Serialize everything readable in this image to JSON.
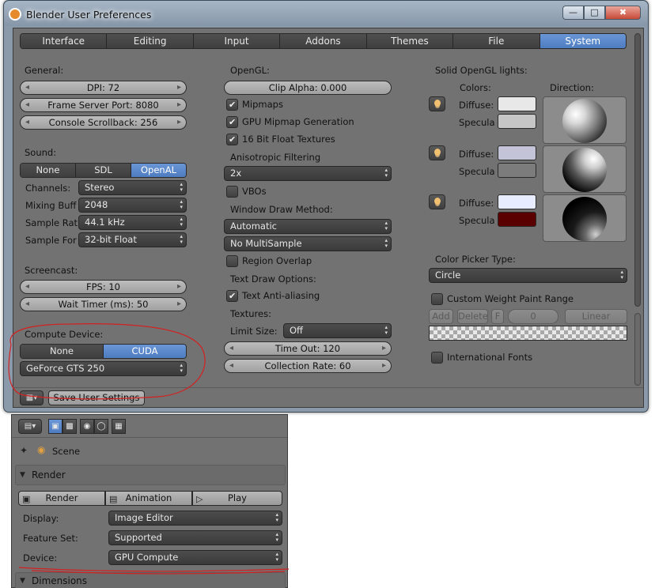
{
  "window": {
    "title": "Blender User Preferences",
    "controls": {
      "minimize": "—",
      "maximize": "□",
      "close": "✖"
    }
  },
  "tabs": [
    "Interface",
    "Editing",
    "Input",
    "Addons",
    "Themes",
    "File",
    "System"
  ],
  "active_tab": "System",
  "general": {
    "header": "General:",
    "dpi": "DPI: 72",
    "frame_server_port": "Frame Server Port: 8080",
    "console_scrollback": "Console Scrollback: 256"
  },
  "sound": {
    "header": "Sound:",
    "options": [
      "None",
      "SDL",
      "OpenAL"
    ],
    "selected": "OpenAL",
    "channels_label": "Channels:",
    "channels_value": "Stereo",
    "mixing_label": "Mixing Buff",
    "mixing_value": "2048",
    "rate_label": "Sample Rat",
    "rate_value": "44.1 kHz",
    "format_label": "Sample For",
    "format_value": "32-bit Float"
  },
  "screencast": {
    "header": "Screencast:",
    "fps": "FPS: 10",
    "wait_timer": "Wait Timer (ms): 50"
  },
  "compute": {
    "header": "Compute Device:",
    "options": [
      "None",
      "CUDA"
    ],
    "selected": "CUDA",
    "device": "GeForce GTS 250"
  },
  "opengl": {
    "header": "OpenGL:",
    "clip_alpha": "Clip Alpha: 0.000",
    "mipmaps": "Mipmaps",
    "gpu_mipmap": "GPU Mipmap Generation",
    "float_textures": "16 Bit Float Textures",
    "aniso_label": "Anisotropic Filtering",
    "aniso_value": "2x",
    "vbos": "VBOs",
    "window_draw_label": "Window Draw Method:",
    "window_draw_value": "Automatic",
    "multisample_value": "No MultiSample",
    "region_overlap": "Region Overlap",
    "text_draw_label": "Text Draw Options:",
    "text_antialias": "Text Anti-aliasing",
    "textures_label": "Textures:",
    "limit_size_label": "Limit Size:",
    "limit_size_value": "Off",
    "time_out": "Time Out: 120",
    "collection_rate": "Collection Rate: 60"
  },
  "lights": {
    "header": "Solid OpenGL lights:",
    "colors_label": "Colors:",
    "direction_label": "Direction:",
    "diffuse_label": "Diffuse:",
    "specular_label": "Specula",
    "items": [
      {
        "diffuse": "#e8e8e8",
        "specular": "#c6c6c6"
      },
      {
        "diffuse": "#c4c4d8",
        "specular": "#7c7c7c"
      },
      {
        "diffuse": "#e8ecff",
        "specular": "#5a0000"
      }
    ]
  },
  "color_picker": {
    "label": "Color Picker Type:",
    "value": "Circle"
  },
  "weight_paint": {
    "label": "Custom Weight Paint Range",
    "add": "Add",
    "delete": "Delete",
    "f": "F",
    "value": "0",
    "interp": "Linear"
  },
  "international_fonts": "International Fonts",
  "save_button": "Save User Settings",
  "properties": {
    "scene_label": "Scene",
    "render_section": "Render",
    "render_btn": "Render",
    "animation_btn": "Animation",
    "play_btn": "Play",
    "display_label": "Display:",
    "display_value": "Image Editor",
    "feature_label": "Feature Set:",
    "feature_value": "Supported",
    "device_label": "Device:",
    "device_value": "GPU Compute",
    "dimensions_section": "Dimensions"
  },
  "colors": {
    "active_blue": "#5a88cc",
    "panel_grey": "#727272",
    "annotation_red": "#d42020"
  }
}
